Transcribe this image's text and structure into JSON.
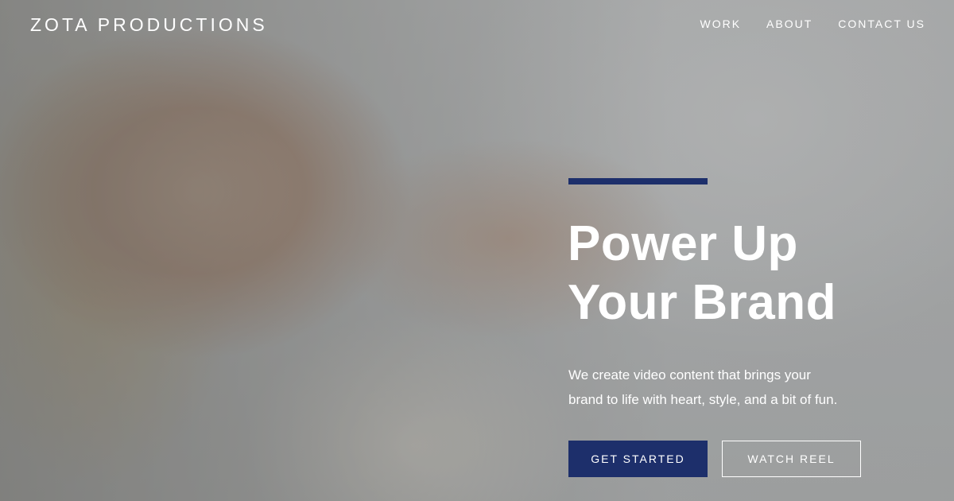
{
  "brand": {
    "logo_text": "ZOTA PRODUCTIONS"
  },
  "nav": {
    "items": [
      {
        "label": "WORK"
      },
      {
        "label": "ABOUT"
      },
      {
        "label": "CONTACT US"
      }
    ]
  },
  "hero": {
    "headline_line1": "Power Up",
    "headline_line2": "Your Brand",
    "subtext_line1": "We create video content that brings your",
    "subtext_line2": "brand to life with heart, style, and a bit of fun.",
    "primary_button": "GET STARTED",
    "secondary_button": "WATCH REEL"
  },
  "colors": {
    "accent": "#1d2f6b",
    "text": "#ffffff"
  }
}
